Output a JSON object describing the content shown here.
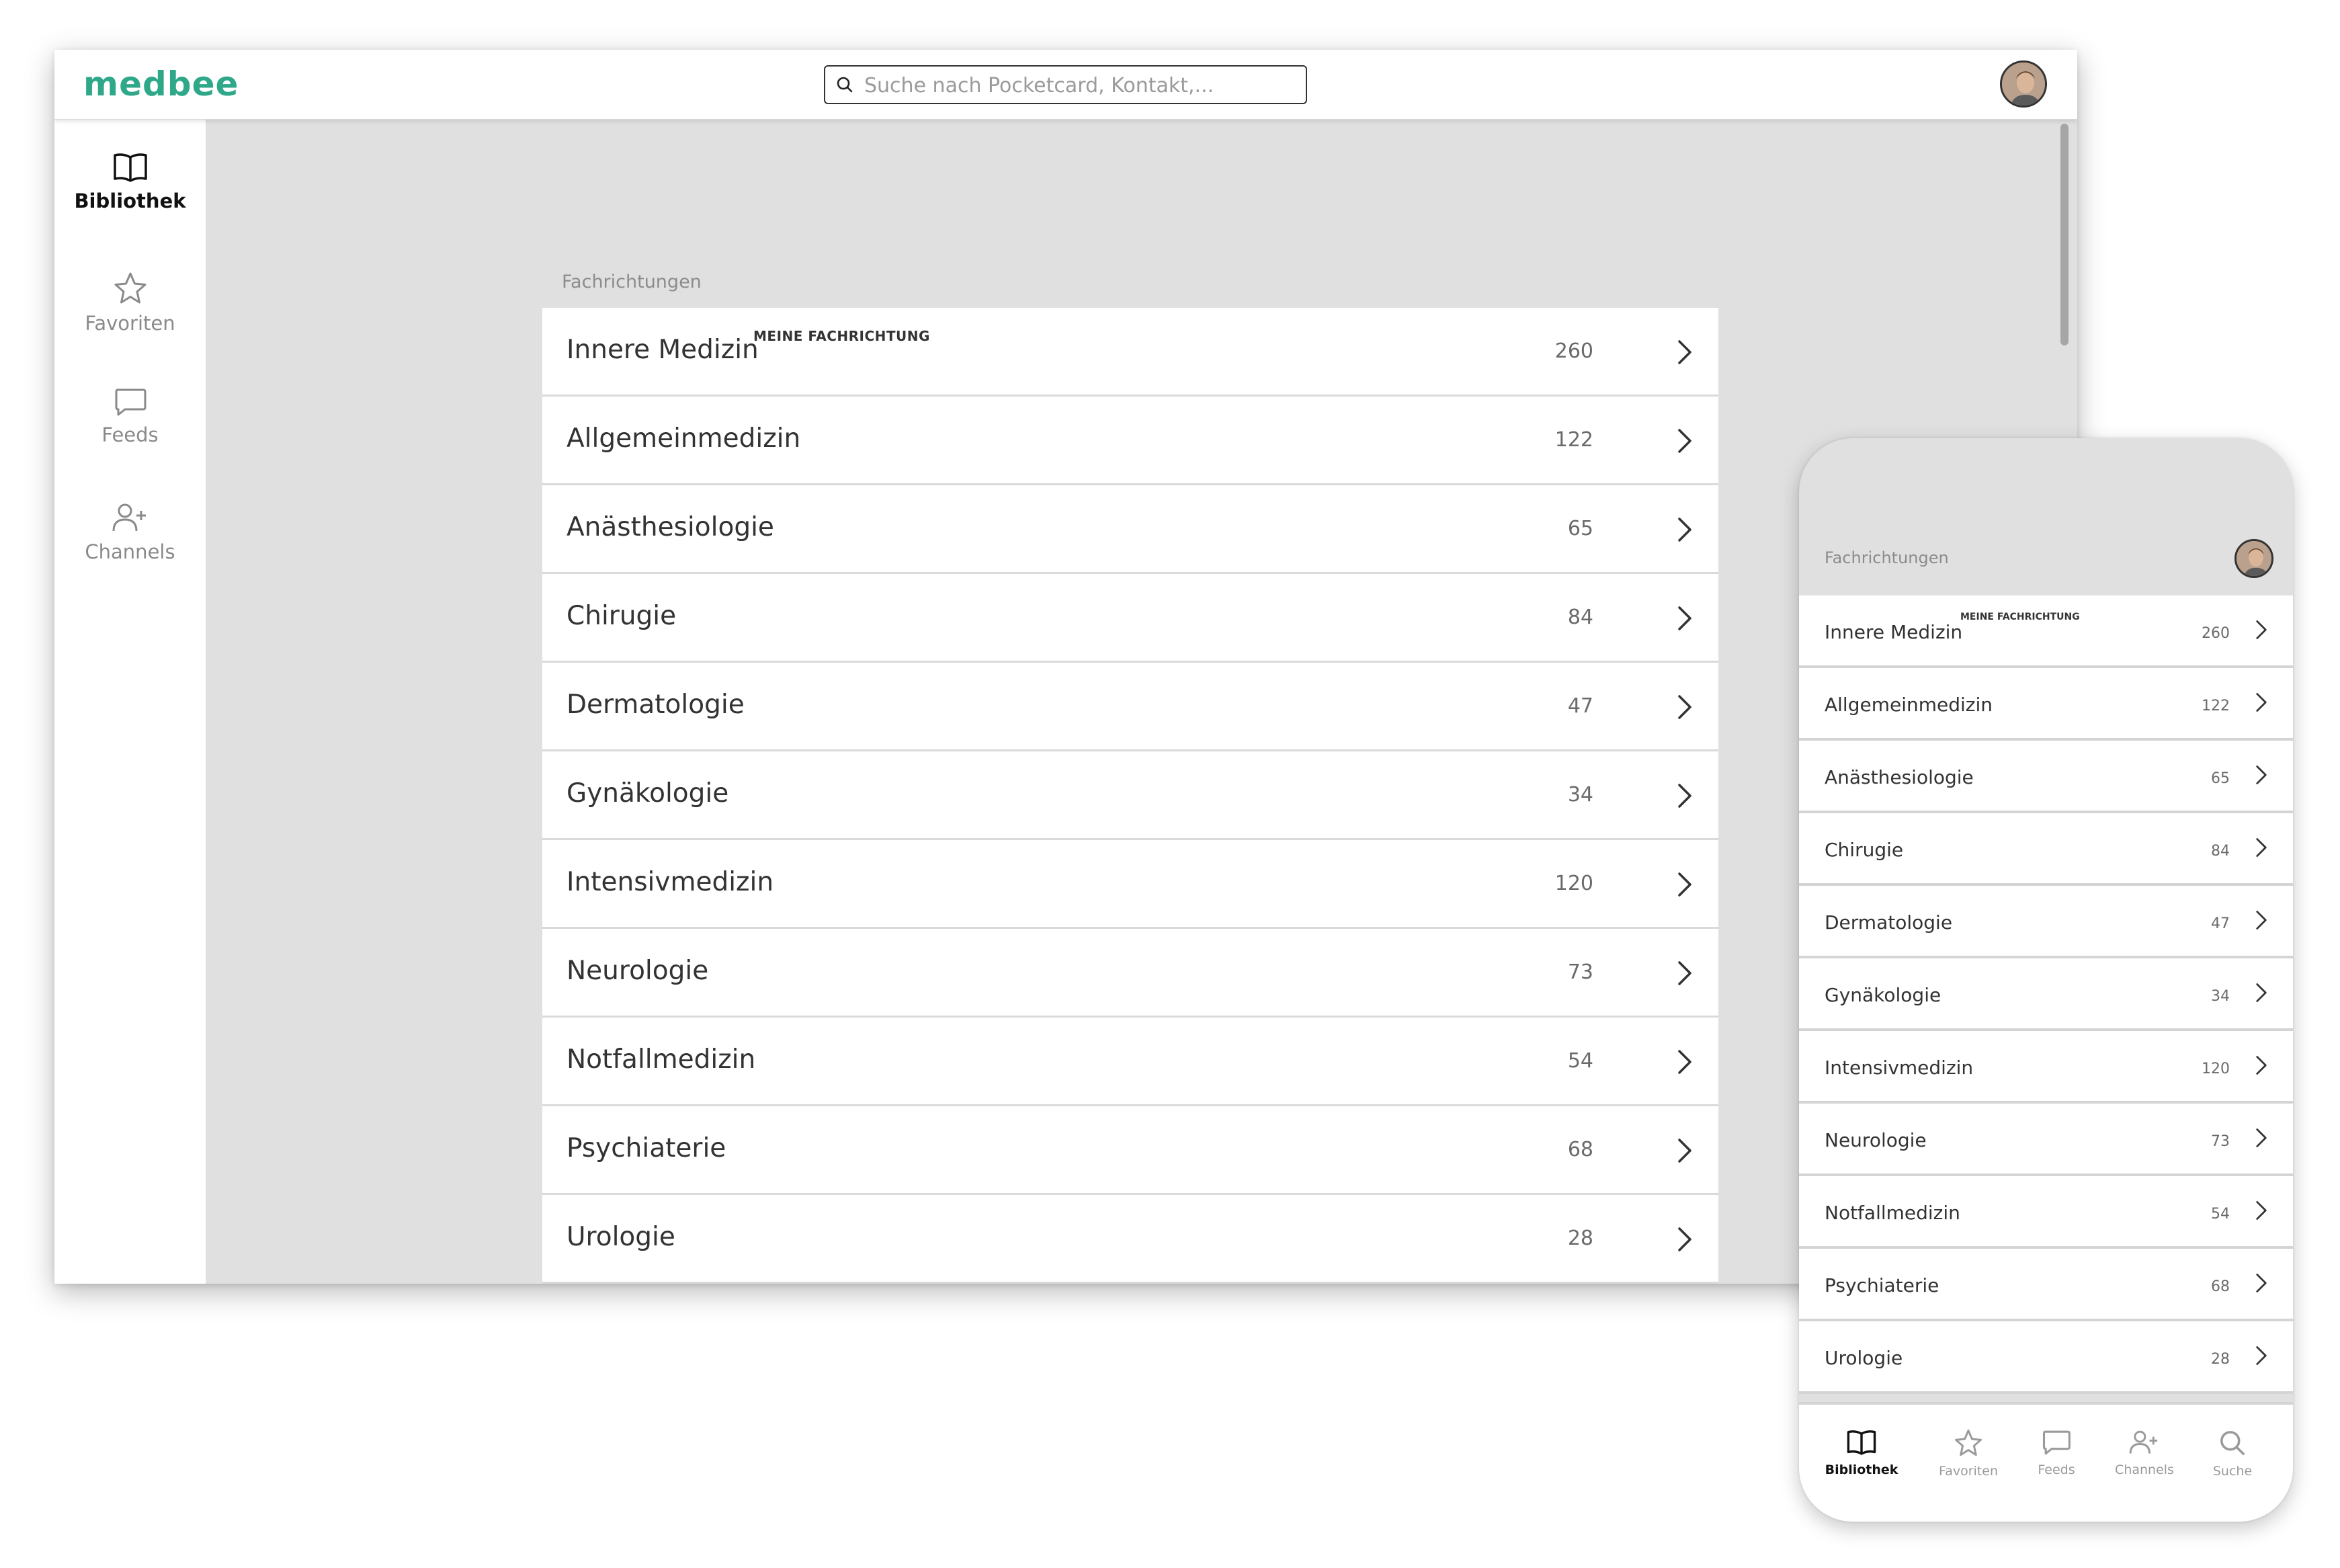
{
  "app": {
    "logo": "medbee"
  },
  "search": {
    "placeholder": "Suche nach Pocketcard, Kontakt,..."
  },
  "sidebar": {
    "items": [
      {
        "label": "Bibliothek",
        "icon": "book-icon",
        "active": true
      },
      {
        "label": "Favoriten",
        "icon": "star-icon",
        "active": false
      },
      {
        "label": "Feeds",
        "icon": "chat-icon",
        "active": false
      },
      {
        "label": "Channels",
        "icon": "user-plus-icon",
        "active": false
      }
    ]
  },
  "main": {
    "section_label": "Fachrichtungen",
    "badge": "MEINE FACHRICHTUNG",
    "specialties": [
      {
        "name": "Innere Medizin",
        "count": "260"
      },
      {
        "name": "Allgemeinmedizin",
        "count": "122"
      },
      {
        "name": "Anästhesiologie",
        "count": "65"
      },
      {
        "name": "Chirugie",
        "count": "84"
      },
      {
        "name": "Dermatologie",
        "count": "47"
      },
      {
        "name": "Gynäkologie",
        "count": "34"
      },
      {
        "name": "Intensivmedizin",
        "count": "120"
      },
      {
        "name": "Neurologie",
        "count": "73"
      },
      {
        "name": "Notfallmedizin",
        "count": "54"
      },
      {
        "name": "Psychiaterie",
        "count": "68"
      },
      {
        "name": "Urologie",
        "count": "28"
      }
    ]
  },
  "phone": {
    "section_label": "Fachrichtungen",
    "tabs": [
      {
        "label": "Bibliothek",
        "icon": "book-icon",
        "active": true
      },
      {
        "label": "Favoriten",
        "icon": "star-icon",
        "active": false
      },
      {
        "label": "Feeds",
        "icon": "chat-icon",
        "active": false
      },
      {
        "label": "Channels",
        "icon": "user-plus-icon",
        "active": false
      },
      {
        "label": "Suche",
        "icon": "search-icon",
        "active": false
      }
    ]
  },
  "colors": {
    "brand": "#2fa88a",
    "background": "#e0e0e0"
  }
}
